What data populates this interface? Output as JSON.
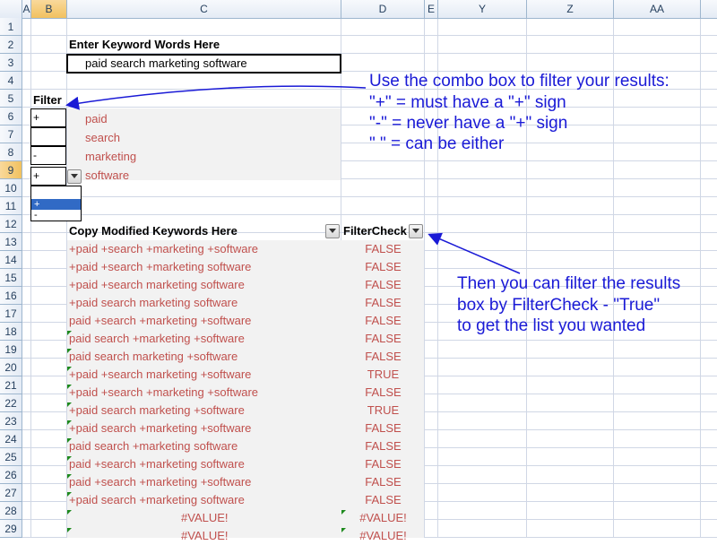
{
  "columns": [
    "A",
    "B",
    "C",
    "D",
    "E",
    "Y",
    "Z",
    "AA"
  ],
  "rows": [
    "1",
    "2",
    "3",
    "4",
    "5",
    "6",
    "7",
    "8",
    "9",
    "10",
    "11",
    "12",
    "13",
    "14",
    "15",
    "16",
    "17",
    "18",
    "19",
    "20",
    "21",
    "22",
    "23",
    "24",
    "25",
    "26",
    "27",
    "28",
    "29"
  ],
  "active_cell": {
    "column": "B",
    "row": "9"
  },
  "keyword_section": {
    "label": "Enter Keyword Words Here",
    "value": "paid search marketing software"
  },
  "filter_section": {
    "label": "Filter",
    "rows": [
      {
        "filter": "+",
        "word": "paid"
      },
      {
        "filter": "",
        "word": "search"
      },
      {
        "filter": "-",
        "word": "marketing"
      },
      {
        "filter": "+",
        "word": "software"
      }
    ],
    "dropdown_options": [
      "",
      "+",
      "-"
    ],
    "dropdown_selected_index": 1
  },
  "results_section": {
    "header_keywords": "Copy Modified Keywords Here",
    "header_check": "FilterCheck",
    "rows": [
      {
        "kw": "+paid +search +marketing +software",
        "check": "FALSE"
      },
      {
        "kw": "+paid +search +marketing software",
        "check": "FALSE"
      },
      {
        "kw": "+paid +search marketing software",
        "check": "FALSE"
      },
      {
        "kw": "+paid search marketing software",
        "check": "FALSE"
      },
      {
        "kw": "paid +search +marketing +software",
        "check": "FALSE"
      },
      {
        "kw": "paid search +marketing +software",
        "check": "FALSE"
      },
      {
        "kw": "paid search marketing +software",
        "check": "FALSE"
      },
      {
        "kw": "+paid +search marketing +software",
        "check": "TRUE"
      },
      {
        "kw": "+paid +search +marketing +software",
        "check": "FALSE"
      },
      {
        "kw": "+paid search marketing +software",
        "check": "TRUE"
      },
      {
        "kw": "+paid search +marketing +software",
        "check": "FALSE"
      },
      {
        "kw": "paid search +marketing software",
        "check": "FALSE"
      },
      {
        "kw": "paid +search +marketing software",
        "check": "FALSE"
      },
      {
        "kw": "paid +search +marketing +software",
        "check": "FALSE"
      },
      {
        "kw": "+paid search +marketing software",
        "check": "FALSE"
      },
      {
        "kw": "#VALUE!",
        "check": "#VALUE!"
      },
      {
        "kw": "#VALUE!",
        "check": "#VALUE!"
      }
    ]
  },
  "annotations": {
    "combo": [
      "Use the combo box to filter your results:",
      "\"+\" = must have a \"+\" sign",
      "\"-\" = never have a \"+\" sign",
      "\" \" = can be either"
    ],
    "filtercheck": [
      "Then you can filter the results",
      "box by FilterCheck - \"True\"",
      "to get the list you wanted"
    ]
  },
  "colors": {
    "annotation": "#1a1ad6",
    "result_text": "#c0504d",
    "grid": "#d0d7e5",
    "header_bg": "#e4ebf5",
    "active_header": "#f1c15f",
    "selection": "#316ac5"
  },
  "icons": {
    "dropdown": "chevron-down-icon",
    "error_marker": "green-triangle-icon"
  }
}
